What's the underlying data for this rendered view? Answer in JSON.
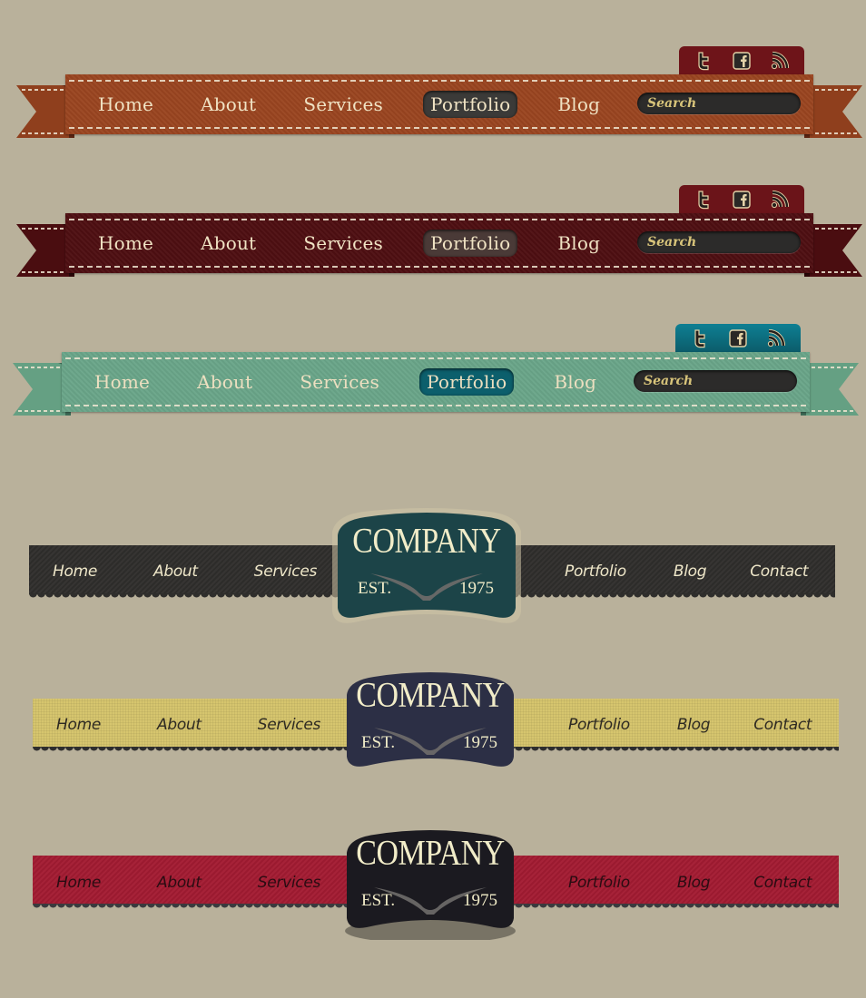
{
  "ribbon_navbars": [
    {
      "theme": "orange",
      "colors": {
        "band": "#9a4520",
        "tail": "#8f3f1d",
        "tail_fold": "#5c2512",
        "social_bg": "#6e1419",
        "active_bg": "#3b3a38",
        "text": "#f0e3c4"
      },
      "nav": [
        {
          "label": "Home",
          "active": false
        },
        {
          "label": "About",
          "active": false
        },
        {
          "label": "Services",
          "active": false
        },
        {
          "label": "Portfolio",
          "active": true
        },
        {
          "label": "Blog",
          "active": false
        }
      ],
      "search": {
        "placeholder": "Search"
      },
      "social": [
        "twitter-icon",
        "facebook-icon",
        "rss-icon"
      ]
    },
    {
      "theme": "maroon",
      "colors": {
        "band": "#4e0f12",
        "tail": "#4a0d10",
        "tail_fold": "#2c0709",
        "social_bg": "#6b1419",
        "active_bg": "#4a3a37",
        "text": "#f0e3c4"
      },
      "nav": [
        {
          "label": "Home",
          "active": false
        },
        {
          "label": "About",
          "active": false
        },
        {
          "label": "Services",
          "active": false
        },
        {
          "label": "Portfolio",
          "active": true
        },
        {
          "label": "Blog",
          "active": false
        }
      ],
      "search": {
        "placeholder": "Search"
      },
      "social": [
        "twitter-icon",
        "facebook-icon",
        "rss-icon"
      ]
    },
    {
      "theme": "mint",
      "colors": {
        "band": "#6aa589",
        "tail": "#65a083",
        "tail_fold": "#3d6b56",
        "social_bg": "#0e7f93",
        "active_bg": "#0c5f6c",
        "text": "#ecdfc0"
      },
      "nav": [
        {
          "label": "Home",
          "active": false
        },
        {
          "label": "About",
          "active": false
        },
        {
          "label": "Services",
          "active": false
        },
        {
          "label": "Portfolio",
          "active": true
        },
        {
          "label": "Blog",
          "active": false
        }
      ],
      "search": {
        "placeholder": "Search"
      },
      "social": [
        "twitter-icon",
        "facebook-icon",
        "rss-icon"
      ]
    }
  ],
  "logo_navbars": [
    {
      "theme": "charcoal",
      "colors": {
        "strip": "#2f2e2c",
        "text": "#efe7c9",
        "badge": "#1c4448",
        "badge_ring": "#cfc4a6",
        "scallop": "#2f2e2c"
      },
      "nav_left": [
        "Home",
        "About",
        "Services"
      ],
      "nav_right": [
        "Portfolio",
        "Blog",
        "Contact"
      ],
      "logo": {
        "name": "COMPANY",
        "est_label": "EST.",
        "year": "1975"
      }
    },
    {
      "theme": "mustard",
      "colors": {
        "strip": "#d6c56e",
        "text": "#2e2a22",
        "badge": "#2c2f45",
        "badge_ring": "#2c2f45",
        "scallop": "#2e2e2e"
      },
      "nav_left": [
        "Home",
        "About",
        "Services"
      ],
      "nav_right": [
        "Portfolio",
        "Blog",
        "Contact"
      ],
      "logo": {
        "name": "COMPANY",
        "est_label": "EST.",
        "year": "1975"
      }
    },
    {
      "theme": "crimson",
      "colors": {
        "strip": "#a31b32",
        "text": "#2a0c12",
        "badge": "#1b1a20",
        "badge_ring": "#1b1a20",
        "scallop": "#3a3a3e"
      },
      "nav_left": [
        "Home",
        "About",
        "Services"
      ],
      "nav_right": [
        "Portfolio",
        "Blog",
        "Contact"
      ],
      "logo": {
        "name": "COMPANY",
        "est_label": "EST.",
        "year": "1975"
      }
    }
  ]
}
